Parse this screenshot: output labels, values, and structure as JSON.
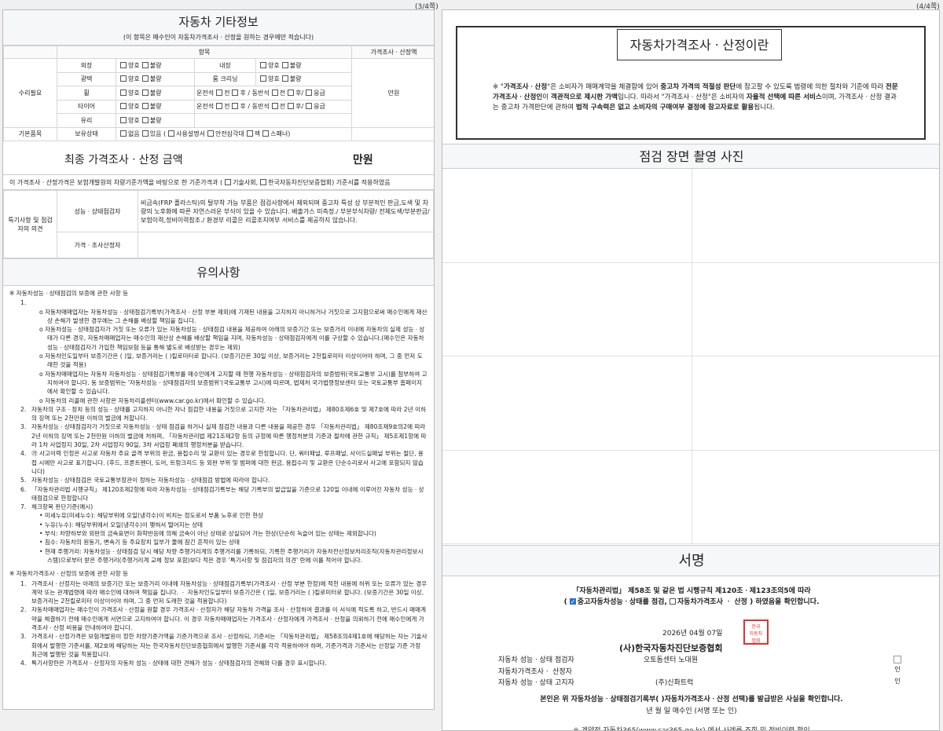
{
  "pages": {
    "p3_num": "(3/4쪽)",
    "p4_num": "(4/4쪽)"
  },
  "other_info": {
    "title": "자동차 기타정보",
    "subtitle": "(이 항목은 매수인이 자동차가격조사ㆍ산정을 원하는 경우에만 적습니다)",
    "col_item": "항목",
    "col_price": "가격조사ㆍ산정액",
    "group_repair": "수리필요",
    "group_basic": "기본품목",
    "price_unit": "만원",
    "good": "양호",
    "bad": "불량",
    "rows": {
      "exterior": "외장",
      "interior": "내장",
      "gloss": "광택",
      "room_clean": "룸 크리닝",
      "wheel": "휠",
      "tire": "타이어",
      "glass": "유리",
      "possession": "보유상태"
    },
    "wheel_opts": {
      "driver": "운전석",
      "front": "전",
      "rear": "후",
      "passenger": "동반석",
      "spare": "응급"
    },
    "possess_opts": {
      "none": "없음",
      "have": "있음",
      "manual": "사용설명서",
      "triangle": "안전삼각대",
      "jack": "잭",
      "spanner": "스패너"
    }
  },
  "final": {
    "label": "최종 가격조사ㆍ산정 금액",
    "value": "만원"
  },
  "basis": {
    "pre": "이 가격조사ㆍ산정가격은 보험개발원의 차량기준가액을 바탕으로 한 기준가격과 (",
    "opt1": "기술사회,",
    "opt2": "한국자동차진단보증협회) 기준서를 적용하였음"
  },
  "special": {
    "label": "특기사항 및 점검자의 의견",
    "row1_label": "성능ㆍ상태점검자",
    "row1_text": "비금속(FRP 플라스틱)의 탈부착 가능 부품은 점검사항에서 제외되며 중고차 특성 상 부분적인 판금,도색 및 차량의 노후화에 따른 자연스러운 부식이 있을 수 있습니다. 배출가스 미측정./ 부분부식차량/ 전체도색/부분판금/ 보험이력,정비이력참조./ 환경부 리콜은 리콜조치여부 서비스를 제공하지 않습니다.",
    "row2_label": "가격ㆍ조사산정자"
  },
  "notes": {
    "title": "유의사항",
    "head1": "※ 자동차성능ㆍ상태점검의 보증에 관한 사항 등",
    "sub1": [
      "자동차매매업자는 자동차성능ㆍ상태점검기록부(가격조사ㆍ산정 부분 제외)에 기재된 내용을 고지하지 아니하거나 거짓으로 고지함으로써 매수인에게 재산상 손해가 발생한 경우에는 그 손해를 배상할 책임을 집니다.",
      "자동차성능ㆍ상태점검자가 거짓 또는 오류가 있는 자동차성능ㆍ상태점검 내용을 제공하여 아래의 보증기간 또는 보증거리 이내에 자동차의 실제 성능ㆍ상태가 다른 경우, 자동차매매업자는 매수인의 재산상 손해를 배상할 책임을 지며, 자동차성능ㆍ상태점검자에게 이를 구상할 수 있습니다.(매수인은 자동차성능ㆍ상태점검자가 가입한 책임보험 등을 통해 별도로 배상받는 경우는 제외)",
      "자동차인도일부터 보증기간은 (      )일, 보증거리는 (      )킬로미터로 합니다. (보증기간은 30일 이상, 보증거리는 2천킬로미터 이상이어야 하며, 그 중 먼저 도래한 것을 적용)",
      "자동차매매업자는 자동차 자동차성능ㆍ상태점검기록부를 매수인에게 고지할 때 현행 자동차성능ㆍ상태점검자의 보증범위(국토교통부 고시)를 첨부하여 고지하여야 합니다. 동 보증범위는 '자동차성능ㆍ상태점검자의 보증범위'(국토교통부 고시)에 따르며, 법제처 국가법령정보센터 또는 국토교통부 홈페이지에서 확인할 수 있습니다.",
      "자동차의 리콜에 관한 사항은 자동차리콜센터(www.car.go.kr)에서 확인할 수 있습니다."
    ],
    "items": [
      "자동차의 구조ㆍ장치 등의 성능ㆍ상태를 고지하지 아니한 자나 점검한 내용을 거짓으로 고지한 자는 「자동차관리법」 제80조제6호 및 제7호에 따라 2년 이하의 징역 또는 2천만원 이하의 벌금에 처합니다.",
      "자동차성능ㆍ상태점검자가 거짓으로 자동차성능ㆍ상태 점검을 하거나 실제 점검한 내용과 다른 내용을 제공한 경우 「자동차관리법」 제80조제9호의2에 따라 2년 이하의 징역 또는 2천만원 이하의 벌금에 처하며, 「자동차관리법 제21조제2항 등의 규정에 따른 행정처분의 기준과 절차에 관한 규칙」 제5조제1항에 따라 1차 사업정지 30일, 2차 사업정지 90일, 3차 사업장 폐쇄의 행정처분을 받습니다.",
      "㉮ 사고이력 인정은 사고로 자동차 주요 골격 부위의 판금, 용접수리 및 교환이 있는 경우로 한정합니다. 단, 쿼터패널, 루프패널, 사이드실패널 부위는 절단, 용접 시에만 사고로 표기합니다. (후드, 프론트펜더, 도어, 트렁크리드 등 외판 부위 및 범퍼에 대한 판금, 용접수리 및 교환은 단순수리로서 사고에 포함되지 않습니다)",
      "자동차성능ㆍ상태점검은 국토교통부장관이 정하는 자동차성능ㆍ상태점검 방법에 따라야 합니다.",
      "「자동차관리법 시행규칙」 제120조제2항에 따라 자동차성능ㆍ상태점검기록부는 해당 기록부의 발급일을 기준으로 120일 이내에 이루어진 자동차 성능ㆍ상태점검으로 한정합니다",
      "체크항목 판단기준(예시)"
    ],
    "judge": [
      "미세누유(미세누수): 해당부위에 오일(냉각수)이 비치는 정도로서 부품 노후로 인한 현상",
      "누유(누수): 해당부위에서 오일(냉각수)이 맺혀서 떨어지는 상태",
      "부식: 차량하부와 외판의 금속표면이 화학반응에 의해 금속이 아닌 상태로 상실되어 가는 현상(단순히 녹슬어 있는 상태는 제외합니다)",
      "침수: 자동차의 원동기, 변속기 등 주요장치 일부가 물에 잠긴 흔적이 있는 상태",
      "현재 주행거리: 자동차성능ㆍ상태점검 당시 해당 차량 주행거리계의 주행거리를 기록하되, 기록한 주행거리가 자동차전산정보처리조직(자동차관리정보시스템)으로부터 받은 주행거리(주행거리계 교체 정보 포함)보다 적은 경우 '특기사항 및 점검자의 의견' 란에 이를 적어야 합니다."
    ],
    "head2": "※ 자동차가격조사ㆍ산정의 보증에 관한 사항 등",
    "items2": [
      "가격조사ㆍ산정자는 아래의 보증기간 또는 보증거리 이내에 자동차성능ㆍ상태점검기록부(가격조사ㆍ산정 부분 한정)에 적힌 내용에 허위 또는 오류가 있는 경우 계약 또는 관계법령에 따라 매수인에 대하여 책임을 집니다. ㆍ 자동차인도일부터 보증기간은 (      )일, 보증거리는 (      )킬로미터로 합니다. (보증기간은 30일 이상, 보증거리는 2천킬로미터 이상이어야 하며, 그 중 먼저 도래한 것을 적용합니다)",
      "자동차매매업자는 매수인이 가격조사ㆍ산정을 원할 경우 가격조사ㆍ산정자가 해당 자동차 가격을 조사ㆍ산정하여 결과를 이 서식에 적도록 하고, 반드시 매매계약을 체결하기 전에 매수인에게 서면으로 고지하여야 합니다. 이 경우 자동차매매업자는 가격조사ㆍ산정자에게 가격조사ㆍ산정을 의뢰하기 전에 매수인에게 가격조사ㆍ산정 비용을 안내하여야 합니다.",
      "가격조사ㆍ산정가격은 보험개발원이 정한 차량기준가액을 기준가격으로 조사ㆍ산정하되, 기준서는 「자동차관리법」 제58조의4제1호에 해당하는 자는 기술사회에서 발행한 기준서를, 제2호에 해당하는 자는 한국자동차진단보증협회에서 발행한 기준서를 각각 적용하여야 하며, 기준가격과 기준서는 산정일 기준 가장 최근에 발행된 것을 적용합니다.",
      "특기사항란은 가격조사ㆍ산정자의 자동차 성능ㆍ상태에 대한 견해가 성능ㆍ상태점검자의 견해와 다를 경우 표시합니다."
    ]
  },
  "p4": {
    "box_title": "자동차가격조사ㆍ산정이란",
    "box_text_1": "※ \"",
    "box_text_b1": "가격조사ㆍ산정",
    "box_text_2": "\"은 소비자가 매매계약을 체결함에 있어 ",
    "box_text_b2": "중고차 가격의 적절성 판단",
    "box_text_3": "에 참고할 수 있도록 법령에 의한 절차와 기준에 따라 ",
    "box_text_b3": "전문 가격조사ㆍ산정인",
    "box_text_4": "이 ",
    "box_text_b4": "객관적으로 제시한 가액",
    "box_text_5": "입니다. 따라서 \"가격조사ㆍ산정\"은 소비자의 ",
    "box_text_b5": "자율적 선택에 따른 서비스",
    "box_text_6": "이며, 가격조사ㆍ산정 결과는 중고차 가격판단에 관하여 ",
    "box_text_b6": "법적 구속력은 없고 소비자의 구매여부 결정에 참고자료로 활용",
    "box_text_7": "됩니다.",
    "photo_title": "점검 장면 촬영 사진",
    "sign_title": "서명",
    "law_line": "「자동차관리법」 제58조 및 같은 법 시행규칙 제120조ㆍ제123조의5에 따라",
    "law_line2_a": "(",
    "law_line2_b": "중고자동차성능ㆍ상태를 점검,",
    "law_line2_c": "자동차가격조사 ㆍ 산정 ) 하였음을 확인합니다.",
    "date": "2026년 04월  07일",
    "org": "(사)한국자동차진단보증협회",
    "seal_text": "한국자동차진단보증협회",
    "role1": "자동차 성능ㆍ상태 점검자",
    "name1": "오토돔센터 노대원",
    "role2": "자동차가격조사ㆍ 산정자",
    "role3": "자동차 성능ㆍ상태 고지자",
    "name3": "(주)신화트럭",
    "stamp_label": "인",
    "stamp_label2": "인",
    "confirm": "본인은 위 자동차성능ㆍ상태점검기록부(  )자동차가격조사ㆍ산정 선택)를 발급받은 사실을 확인합니다.",
    "confirm2": "년    월    일      매수인                    (서명 또는 인)",
    "cut": "※ 계약전 자동차365(www.car365.go.kr) 에서 사례를 조회 및 정비이력 확인"
  }
}
